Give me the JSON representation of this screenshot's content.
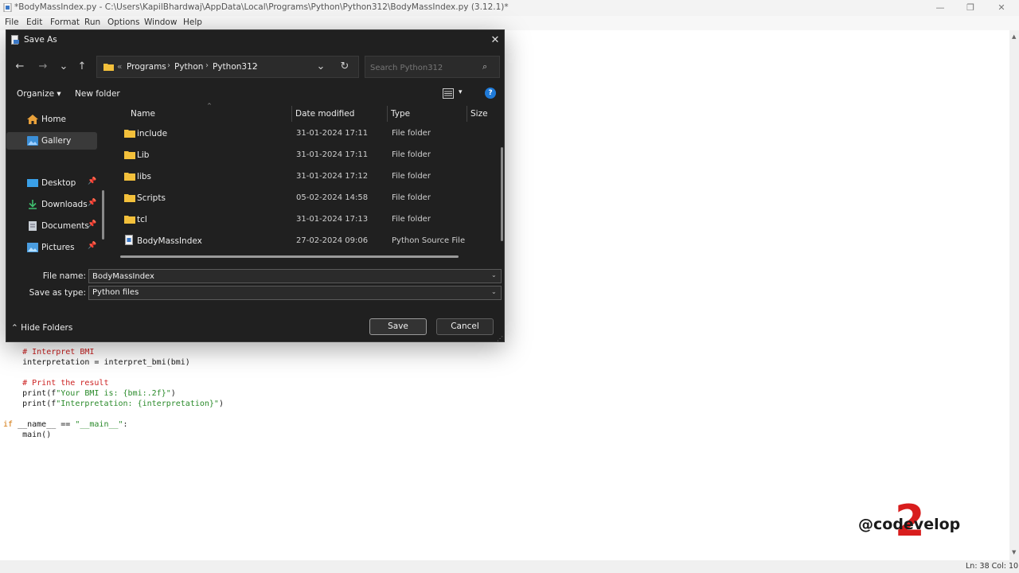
{
  "window": {
    "title": "*BodyMassIndex.py - C:\\Users\\KapilBhardwaj\\AppData\\Local\\Programs\\Python\\Python312\\BodyMassIndex.py (3.12.1)*",
    "minimize": "—",
    "maximize": "❐",
    "close": "✕"
  },
  "menu": {
    "items": [
      "File",
      "Edit",
      "Format",
      "Run",
      "Options",
      "Window",
      "Help"
    ]
  },
  "code": {
    "lines": [
      {
        "pre": "    ",
        "comment": "# Interpret BMI"
      },
      {
        "pre": "    ",
        "text": "interpretation = interpret_bmi(bmi)"
      },
      {
        "pre": "",
        "text": ""
      },
      {
        "pre": "    ",
        "comment": "# Print the result"
      },
      {
        "pre": "    ",
        "fn": "print(f",
        "str": "\"Your BMI is: {bmi:.2f}\"",
        "end": ")"
      },
      {
        "pre": "    ",
        "fn": "print(f",
        "str": "\"Interpretation: {interpretation}\"",
        "end": ")"
      },
      {
        "pre": "",
        "text": ""
      },
      {
        "pre": "",
        "kw": "if",
        "mid": " __name__ == ",
        "str": "\"__main__\"",
        "end": ":"
      },
      {
        "pre": "    ",
        "text": "main()"
      }
    ]
  },
  "status": {
    "position": "Ln: 38   Col: 10"
  },
  "watermark": {
    "big": "2",
    "text": "@codevelop"
  },
  "dialog": {
    "title": "Save As",
    "close": "✕",
    "nav": {
      "back": "←",
      "forward": "→",
      "recent": "⌄",
      "up": "↑",
      "refresh": "↻",
      "address_dropdown": "⌄",
      "breadcrumbs": [
        "«",
        "Programs",
        "Python",
        "Python312"
      ],
      "separators": [
        "›",
        "›",
        "›"
      ]
    },
    "search": {
      "placeholder": "Search Python312",
      "icon": "⌕"
    },
    "toolbar": {
      "organize": "Organize ▾",
      "new_folder": "New folder",
      "view_dropdown": "▾",
      "help": "?"
    },
    "sidebar": {
      "items": [
        {
          "label": "Home",
          "icon": "home-icon",
          "pinned": false,
          "selected": false
        },
        {
          "label": "Gallery",
          "icon": "gallery-icon",
          "pinned": false,
          "selected": true
        },
        {
          "label": "Desktop",
          "icon": "desktop-icon",
          "pinned": true,
          "selected": false
        },
        {
          "label": "Downloads",
          "icon": "downloads-icon",
          "pinned": true,
          "selected": false
        },
        {
          "label": "Documents",
          "icon": "documents-icon",
          "pinned": true,
          "selected": false
        },
        {
          "label": "Pictures",
          "icon": "pictures-icon",
          "pinned": true,
          "selected": false
        }
      ],
      "pin_glyph": "📌"
    },
    "columns": [
      "Name",
      "Date modified",
      "Type",
      "Size"
    ],
    "sort_indicator": "^",
    "files": [
      {
        "name": "include",
        "date": "31-01-2024 17:11",
        "type": "File folder",
        "kind": "folder"
      },
      {
        "name": "Lib",
        "date": "31-01-2024 17:11",
        "type": "File folder",
        "kind": "folder"
      },
      {
        "name": "libs",
        "date": "31-01-2024 17:12",
        "type": "File folder",
        "kind": "folder"
      },
      {
        "name": "Scripts",
        "date": "05-02-2024 14:58",
        "type": "File folder",
        "kind": "folder"
      },
      {
        "name": "tcl",
        "date": "31-01-2024 17:13",
        "type": "File folder",
        "kind": "folder"
      },
      {
        "name": "BodyMassIndex",
        "date": "27-02-2024 09:06",
        "type": "Python Source File",
        "kind": "file"
      }
    ],
    "file_name_label": "File name:",
    "file_name_value": "BodyMassIndex",
    "save_type_label": "Save as type:",
    "save_type_value": "Python files",
    "dropdown_glyph": "⌄",
    "hide_folders": "⌃  Hide Folders",
    "save_button": "Save",
    "cancel_button": "Cancel",
    "resize_grip": "⋰"
  },
  "colors": {
    "dialog_bg": "#202020",
    "folder": "#f3c03b",
    "watermark_red": "#d81d1d",
    "comment": "#cc2222",
    "string": "#2a8a2a",
    "keyword": "#d07000"
  }
}
